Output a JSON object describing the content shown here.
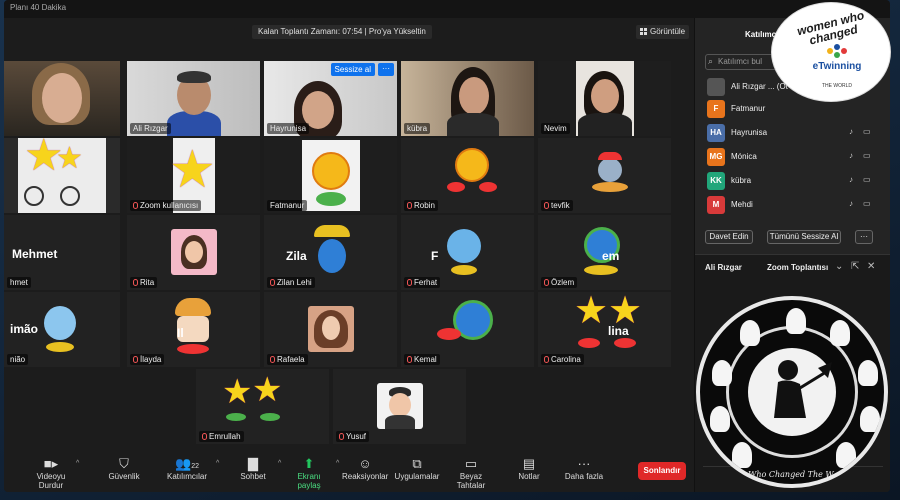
{
  "window": {
    "title": "Planı 40 Dakika"
  },
  "topbar": {
    "meeting_time": "Kalan Toplantı Zamanı: 07:54 | Pro'ya Yükseltin",
    "view_label": "Görüntüle"
  },
  "tiles": [
    {
      "name": "",
      "big": "",
      "muted": false
    },
    {
      "name": "Ali Rızgar",
      "big": "",
      "muted": false
    },
    {
      "name": "Hayrunisa",
      "big": "",
      "muted": false,
      "mute_all_label": "Sessize al",
      "more_label": "···"
    },
    {
      "name": "kübra",
      "big": "",
      "muted": false
    },
    {
      "name": "Nevim",
      "big": "",
      "muted": false
    },
    {
      "name": "",
      "big": "",
      "muted": false
    },
    {
      "name": "Zoom kullanıcısı",
      "big": "",
      "muted": true
    },
    {
      "name": "Fatmanur",
      "big": "",
      "muted": false
    },
    {
      "name": "Robin",
      "big": "",
      "muted": true
    },
    {
      "name": "tevfik",
      "big": "",
      "muted": true
    },
    {
      "name": "hmet",
      "big": "Mehmet",
      "muted": false
    },
    {
      "name": "Rita",
      "big": "",
      "muted": true
    },
    {
      "name": "Zilan Lehi",
      "big": "Zila",
      "muted": true
    },
    {
      "name": "Ferhat",
      "big": "F",
      "muted": true
    },
    {
      "name": "Özlem",
      "big": "em",
      "muted": true
    },
    {
      "name": "nião",
      "big": "imão",
      "muted": false
    },
    {
      "name": "İlayda",
      "big": "Il",
      "muted": true
    },
    {
      "name": "Rafaela",
      "big": "",
      "muted": true
    },
    {
      "name": "Kemal",
      "big": "",
      "muted": true
    },
    {
      "name": "Carolina",
      "big": "lina",
      "muted": true
    },
    {
      "name": "Emrullah",
      "big": "",
      "muted": true
    },
    {
      "name": "Yusuf",
      "big": "",
      "muted": true
    }
  ],
  "toolbar": {
    "video": "Videoyu Durdur",
    "security": "Güvenlik",
    "participants": "Katılımcılar",
    "participants_count": "22",
    "chat": "Sohbet",
    "share": "Ekranı paylaş",
    "reactions": "Reaksiyonlar",
    "apps": "Uygulamalar",
    "whiteboard": "Beyaz Tahtalar",
    "notes": "Notlar",
    "more": "Daha fazla",
    "end": "Sonlandır"
  },
  "panel": {
    "header": "Katılımcılar",
    "search_placeholder": "Katılımcı bul",
    "participants": [
      {
        "initials": "",
        "name": "Ali Rızgar ... (Ot",
        "color": "#555555"
      },
      {
        "initials": "F",
        "name": "Fatmanur",
        "color": "#e8741c"
      },
      {
        "initials": "HA",
        "name": "Hayrunisa",
        "color": "#4a6ea8"
      },
      {
        "initials": "MG",
        "name": "Mónica",
        "color": "#e8741c"
      },
      {
        "initials": "KK",
        "name": "kübra",
        "color": "#21a67a"
      },
      {
        "initials": "M",
        "name": "Mehdi",
        "color": "#d83a3a"
      }
    ],
    "invite_label": "Davet Edin",
    "mute_all_label": "Tümünü Sessize Al",
    "more_label": "···"
  },
  "chat_panel": {
    "header": "Ali Rızgar",
    "title": "Zoom Toplantısı"
  },
  "logo": {
    "text": "women who changed",
    "brand": "eTwinning",
    "sub": "THE WORLD"
  },
  "medallion": {
    "text": "Who Changed The W..."
  }
}
